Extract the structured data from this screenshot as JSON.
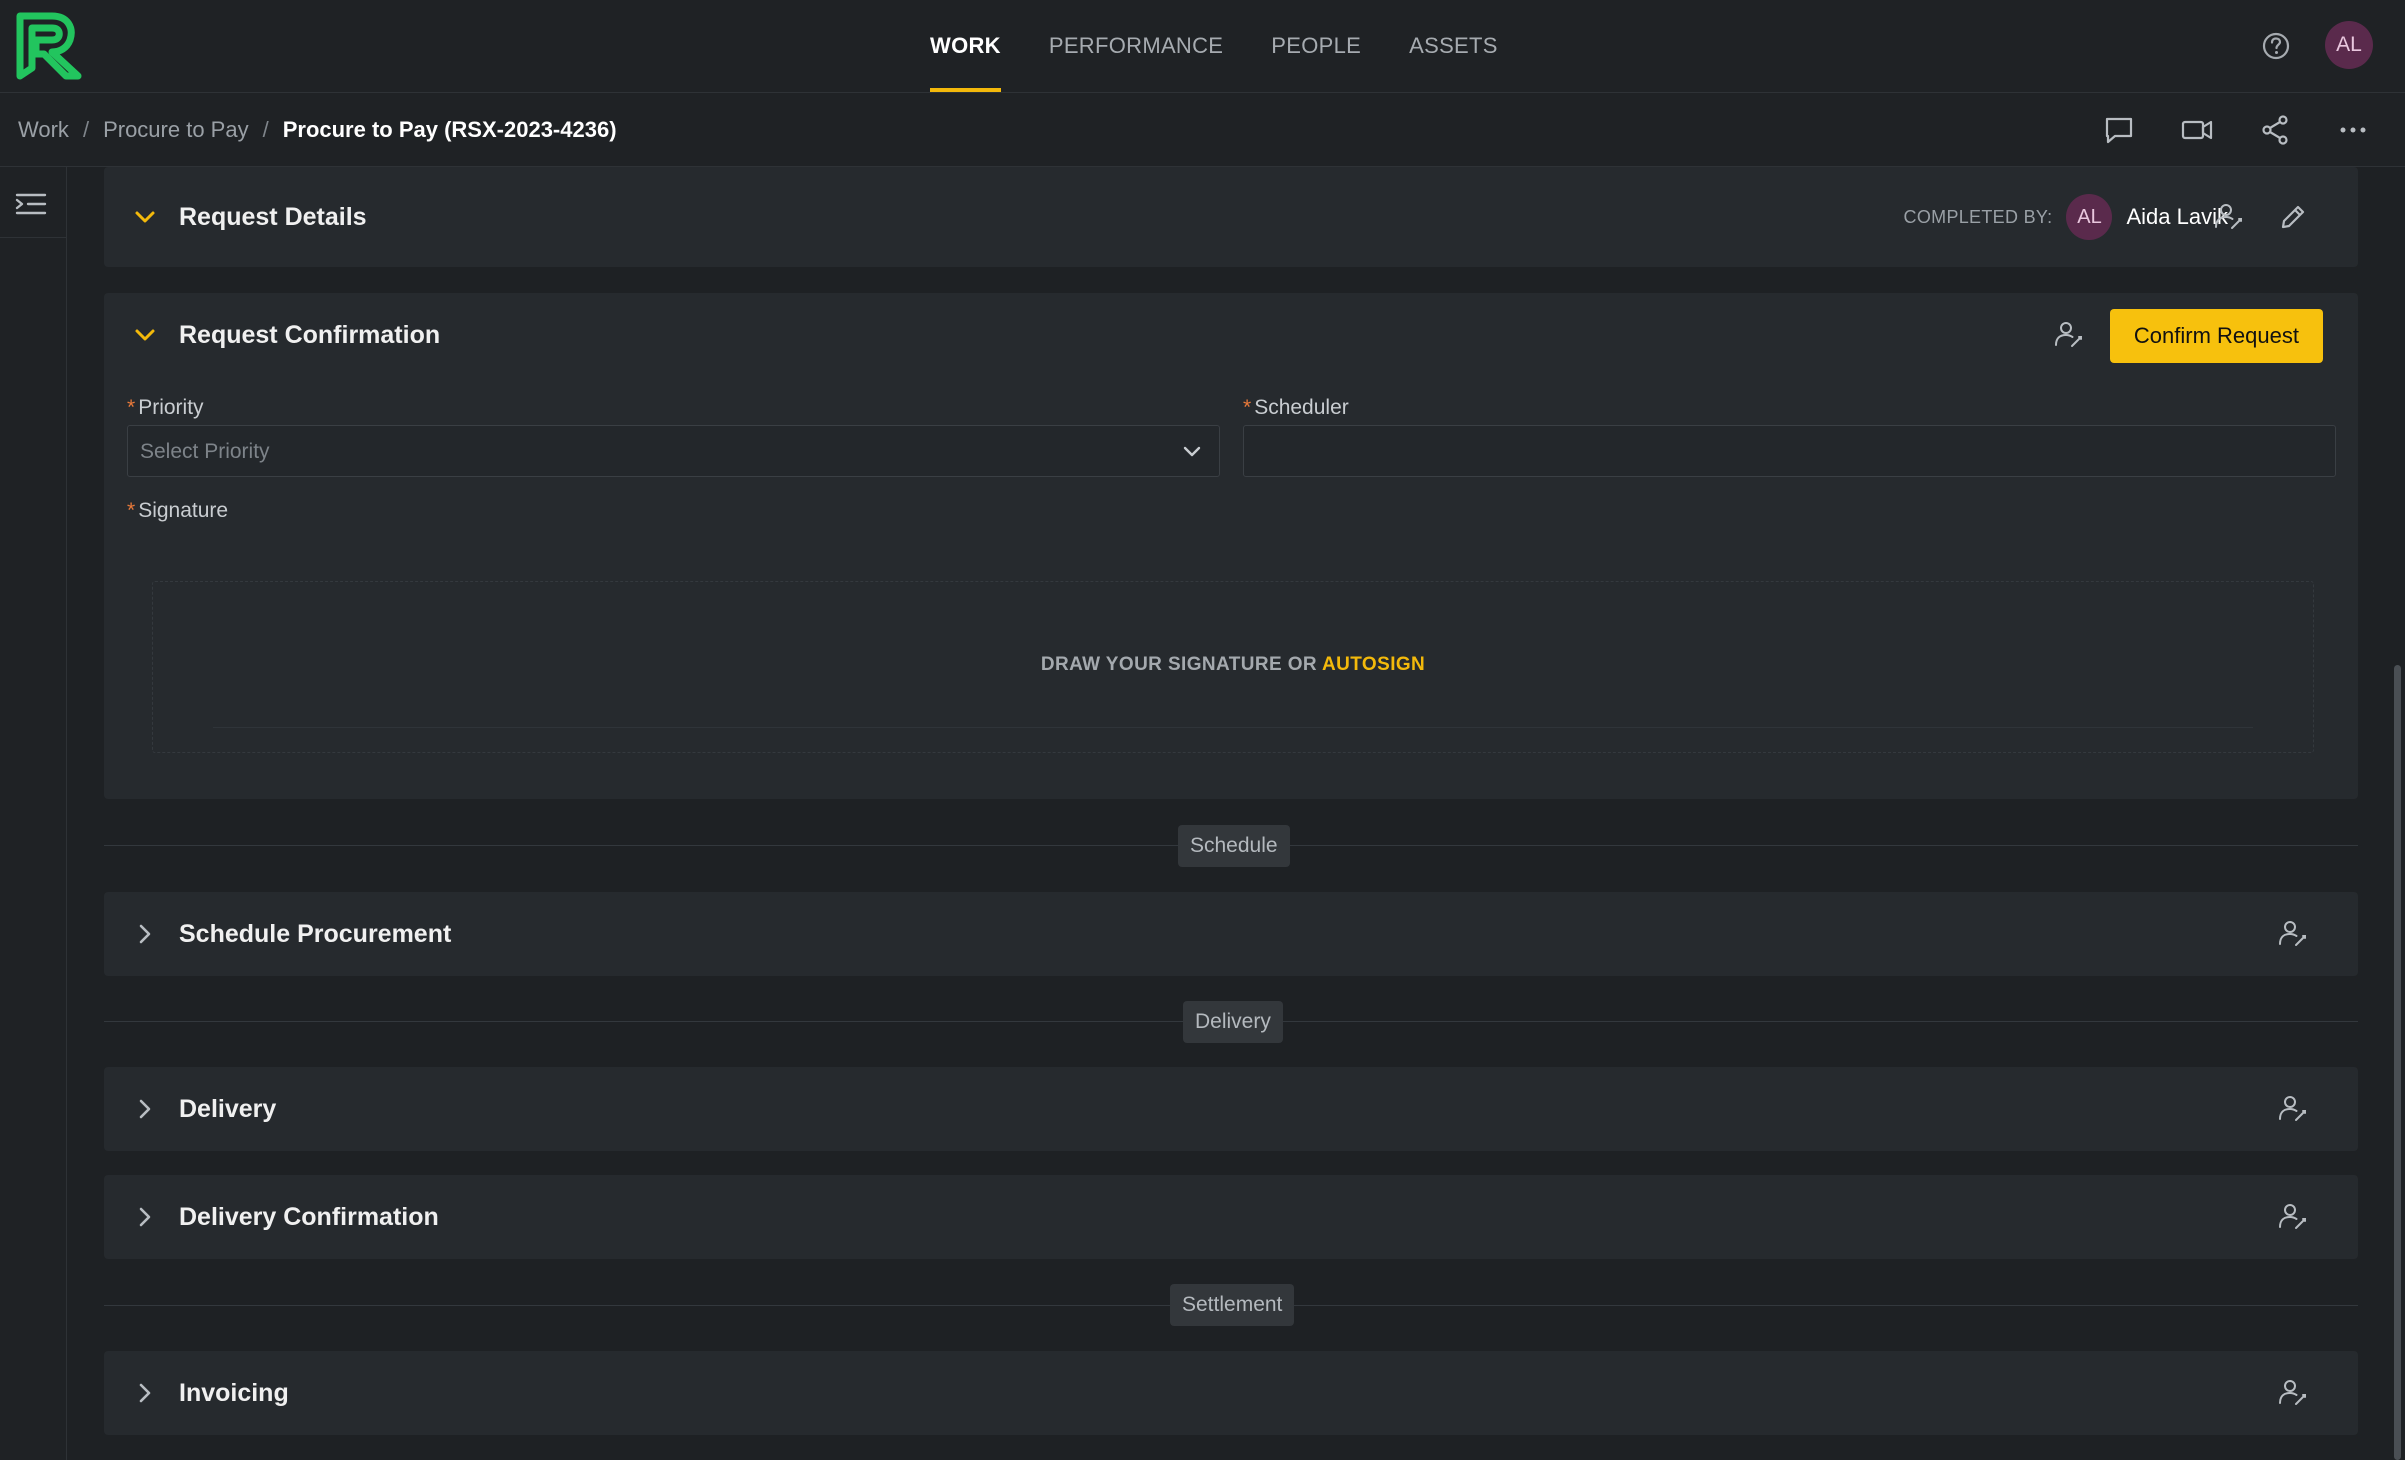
{
  "nav": {
    "items": [
      {
        "label": "WORK",
        "active": true
      },
      {
        "label": "PERFORMANCE",
        "active": false
      },
      {
        "label": "PEOPLE",
        "active": false
      },
      {
        "label": "ASSETS",
        "active": false
      }
    ],
    "user_initials": "AL",
    "accent_color": "#f3b90b",
    "logo_color": "#22c55e"
  },
  "breadcrumb": {
    "items": [
      "Work",
      "Procure to Pay"
    ],
    "current": "Procure to Pay (RSX-2023-4236)",
    "separator": "/"
  },
  "sections": {
    "request_details": {
      "title": "Request Details",
      "completed_by_label": "COMPLETED BY:",
      "completed_by_initials": "AL",
      "completed_by_name": "Aida Lavik"
    },
    "request_confirmation": {
      "title": "Request Confirmation",
      "confirm_button": "Confirm Request",
      "priority": {
        "label": "Priority",
        "required": "*",
        "placeholder": "Select Priority"
      },
      "scheduler": {
        "label": "Scheduler",
        "required": "*",
        "value": ""
      },
      "signature": {
        "label": "Signature",
        "required": "*",
        "prompt": "DRAW YOUR SIGNATURE OR ",
        "autosign": "AUTOSIGN"
      }
    },
    "phases": {
      "schedule": "Schedule",
      "delivery": "Delivery",
      "settlement": "Settlement"
    },
    "schedule_procurement": {
      "title": "Schedule Procurement"
    },
    "delivery": {
      "title": "Delivery"
    },
    "delivery_confirmation": {
      "title": "Delivery Confirmation"
    },
    "invoicing": {
      "title": "Invoicing"
    }
  }
}
